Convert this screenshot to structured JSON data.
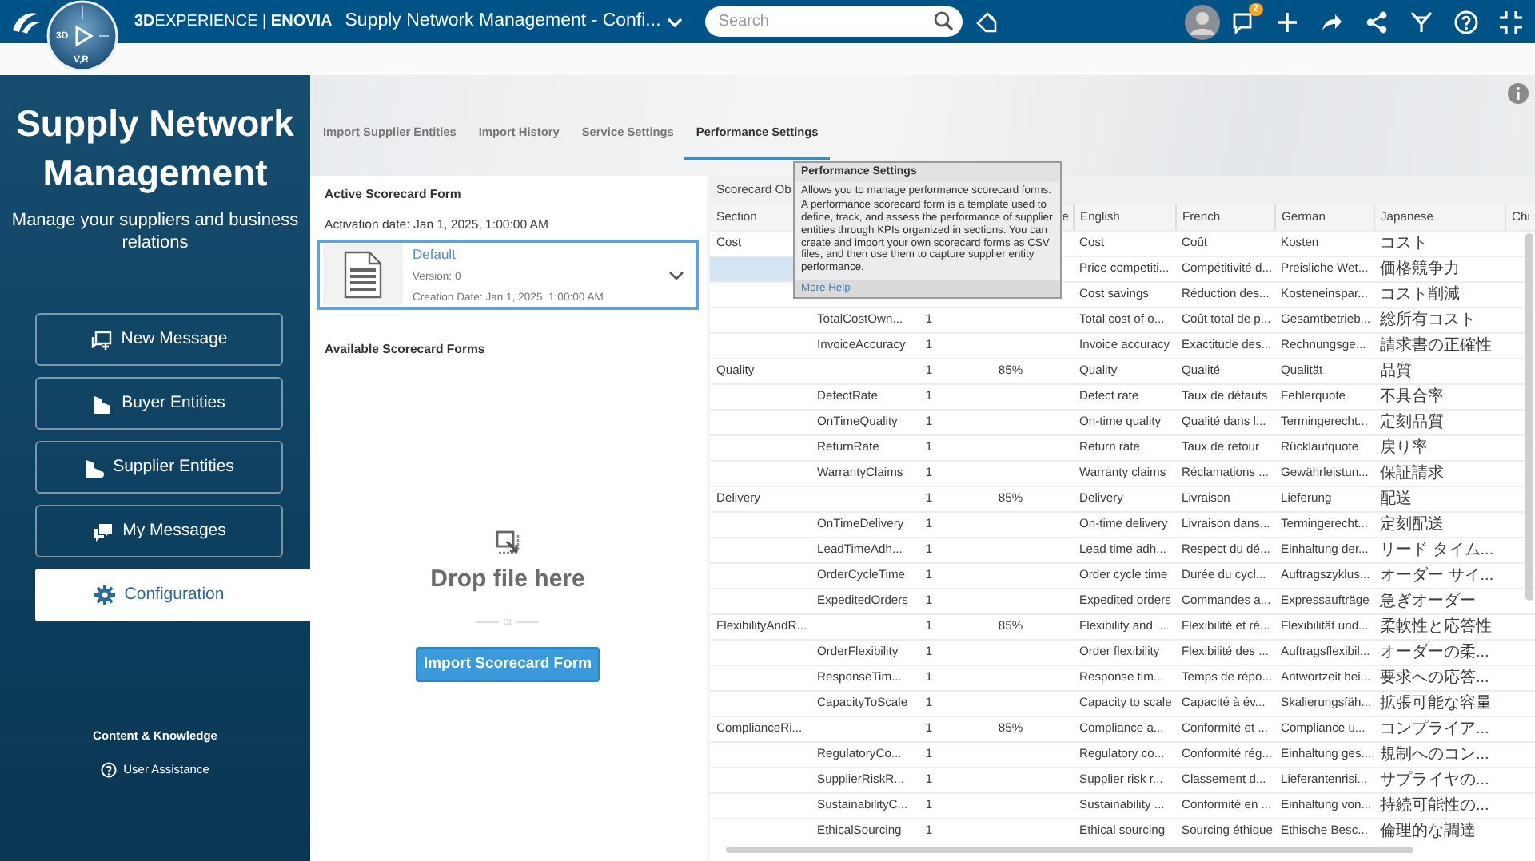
{
  "topbar": {
    "brand": "**3D**EXPERIENCE | **ENOVIA**",
    "app_title": "Supply Network Management - Confi...",
    "search": {
      "placeholder": "Search"
    },
    "notification_count": "2"
  },
  "compass": {
    "labels": [
      "3D",
      "V,R"
    ]
  },
  "sidebar": {
    "title": "Supply Network Management",
    "subtitle": "Manage your suppliers and business relations",
    "items": [
      {
        "label": "New Message",
        "selected": false
      },
      {
        "label": "Buyer Entities",
        "selected": false
      },
      {
        "label": "Supplier Entities",
        "selected": false
      },
      {
        "label": "My Messages",
        "selected": false
      },
      {
        "label": "Configuration",
        "selected": true
      }
    ],
    "footer_heading": "Content & Knowledge",
    "footer_link": "User Assistance"
  },
  "tabs": [
    {
      "label": "Import Supplier Entities",
      "selected": false
    },
    {
      "label": "Import History",
      "selected": false
    },
    {
      "label": "Service Settings",
      "selected": false
    },
    {
      "label": "Performance Settings",
      "selected": true
    }
  ],
  "active_form": {
    "heading": "Active Scorecard Form",
    "activation": "Activation date: Jan 1, 2025, 1:00:00 AM",
    "card": {
      "name": "Default",
      "version": "Version: 0",
      "created": "Creation Date: Jan 1, 2025, 1:00:00 AM"
    }
  },
  "available": {
    "heading": "Available Scorecard Forms",
    "drop_text": "Drop file here",
    "separator": "or",
    "button": "Import Scorecard Form"
  },
  "table": {
    "group_header": "Scorecard Ob",
    "columns": {
      "section": "Section",
      "column_4": "e",
      "english": "English",
      "french": "French",
      "german": "German",
      "japanese": "Japanese",
      "column_9": "Chi"
    },
    "rows": [
      {
        "section": "Cost",
        "english": "Cost",
        "french": "Coût",
        "german": "Kosten",
        "japanese": "コスト",
        "selected": false
      },
      {
        "english": "Price competiti...",
        "french": "Compétitivité d...",
        "german": "Preisliche Wet...",
        "japanese": "価格競争力",
        "selected": true
      },
      {
        "english": "Cost savings",
        "french": "Réduction des...",
        "german": "Kosteneinspar...",
        "japanese": "コスト削減",
        "selected": false
      },
      {
        "column_2": "TotalCostOwn...",
        "column_3": "1",
        "english": "Total cost of o...",
        "french": "Coût total de p...",
        "german": "Gesamtbetrieb...",
        "japanese": "総所有コスト",
        "selected": false
      },
      {
        "column_2": "InvoiceAccuracy",
        "column_3": "1",
        "english": "Invoice accuracy",
        "french": "Exactitude des...",
        "german": "Rechnungsge...",
        "japanese": "請求書の正確性",
        "selected": false
      },
      {
        "section": "Quality",
        "column_3": "1",
        "column_4": "85%",
        "english": "Quality",
        "french": "Qualité",
        "german": "Qualität",
        "japanese": "品質",
        "selected": false
      },
      {
        "column_2": "DefectRate",
        "column_3": "1",
        "english": "Defect rate",
        "french": "Taux de défauts",
        "german": "Fehlerquote",
        "japanese": "不具合率",
        "selected": false
      },
      {
        "column_2": "OnTimeQuality",
        "column_3": "1",
        "english": "On-time quality",
        "french": "Qualité dans l...",
        "german": "Termingerecht...",
        "japanese": "定刻品質",
        "selected": false
      },
      {
        "column_2": "ReturnRate",
        "column_3": "1",
        "english": "Return rate",
        "french": "Taux de retour",
        "german": "Rücklaufquote",
        "japanese": "戻り率",
        "selected": false
      },
      {
        "column_2": "WarrantyClaims",
        "column_3": "1",
        "english": "Warranty claims",
        "french": "Réclamations ...",
        "german": "Gewährleistun...",
        "japanese": "保証請求",
        "selected": false
      },
      {
        "section": "Delivery",
        "column_3": "1",
        "column_4": "85%",
        "english": "Delivery",
        "french": "Livraison",
        "german": "Lieferung",
        "japanese": "配送",
        "selected": false
      },
      {
        "column_2": "OnTimeDelivery",
        "column_3": "1",
        "english": "On-time delivery",
        "french": "Livraison dans...",
        "german": "Termingerecht...",
        "japanese": "定刻配送",
        "selected": false
      },
      {
        "column_2": "LeadTimeAdh...",
        "column_3": "1",
        "english": "Lead time adh...",
        "french": "Respect du dé...",
        "german": "Einhaltung der...",
        "japanese": "リード タイム...",
        "selected": false
      },
      {
        "column_2": "OrderCycleTime",
        "column_3": "1",
        "english": "Order cycle time",
        "french": "Durée du cycl...",
        "german": "Auftragszyklus...",
        "japanese": "オーダー サイ...",
        "selected": false
      },
      {
        "column_2": "ExpeditedOrders",
        "column_3": "1",
        "english": "Expedited orders",
        "french": "Commandes a...",
        "german": "Expressaufträge",
        "japanese": "急ぎオーダー",
        "selected": false
      },
      {
        "section": "FlexibilityAndR...",
        "column_3": "1",
        "column_4": "85%",
        "english": "Flexibility and ...",
        "french": "Flexibilité et ré...",
        "german": "Flexibilität und...",
        "japanese": "柔軟性と応答性",
        "selected": false
      },
      {
        "column_2": "OrderFlexibility",
        "column_3": "1",
        "english": "Order flexibility",
        "french": "Flexibilité des ...",
        "german": "Auftragsflexibil...",
        "japanese": "オーダーの柔...",
        "selected": false
      },
      {
        "column_2": "ResponseTim...",
        "column_3": "1",
        "english": "Response tim...",
        "french": "Temps de répo...",
        "german": "Antwortzeit bei...",
        "japanese": "要求への応答...",
        "selected": false
      },
      {
        "column_2": "CapacityToScale",
        "column_3": "1",
        "english": "Capacity to scale",
        "french": "Capacité à év...",
        "german": "Skalierungsfäh...",
        "japanese": "拡張可能な容量",
        "selected": false
      },
      {
        "section": "ComplianceRi...",
        "column_3": "1",
        "column_4": "85%",
        "english": "Compliance a...",
        "french": "Conformité et ...",
        "german": "Compliance u...",
        "japanese": "コンプライア...",
        "selected": false
      },
      {
        "column_2": "RegulatoryCo...",
        "column_3": "1",
        "english": "Regulatory co...",
        "french": "Conformité rég...",
        "german": "Einhaltung ges...",
        "japanese": "規制へのコン...",
        "selected": false
      },
      {
        "column_2": "SupplierRiskR...",
        "column_3": "1",
        "english": "Supplier risk r...",
        "french": "Classement d...",
        "german": "Lieferantenrisi...",
        "japanese": "サプライヤの...",
        "selected": false
      },
      {
        "column_2": "SustainabilityC...",
        "column_3": "1",
        "english": "Sustainability ...",
        "french": "Conformité en ...",
        "german": "Einhaltung von...",
        "japanese": "持続可能性の...",
        "selected": false
      },
      {
        "column_2": "EthicalSourcing",
        "column_3": "1",
        "english": "Ethical sourcing",
        "french": "Sourcing éthique",
        "german": "Ethische Besc...",
        "japanese": "倫理的な調達",
        "selected": false
      }
    ]
  },
  "tooltip": {
    "title": "Performance Settings",
    "paragraphs": [
      "Allows you to manage performance scorecard forms.",
      "A performance scorecard form is a template used to define, track, and assess the performance of supplier entities through KPIs organized in sections. You can create and import your own scorecard forms as CSV files, and then use them to capture supplier entity performance."
    ],
    "link": "More Help"
  }
}
